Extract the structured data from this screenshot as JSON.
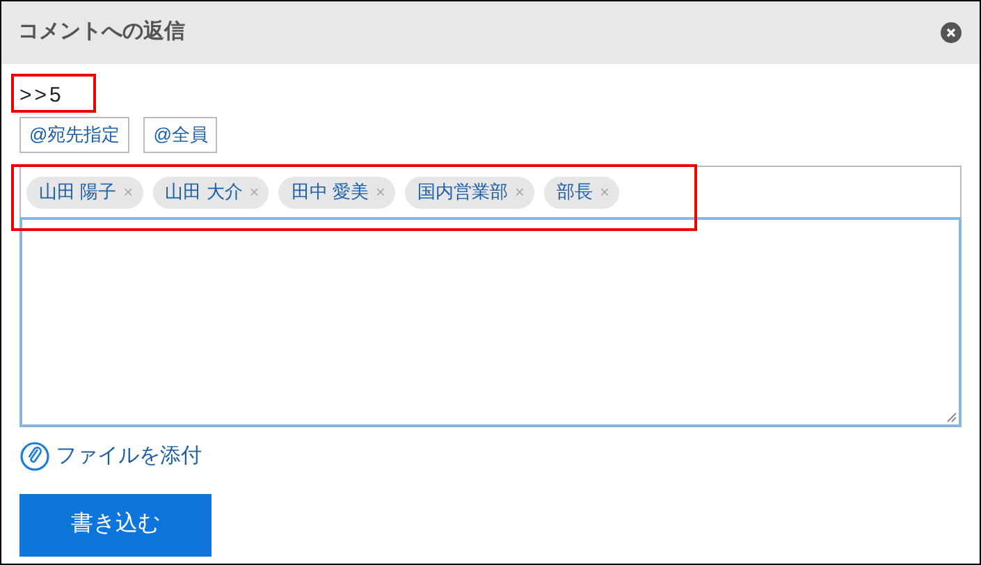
{
  "dialog": {
    "title": "コメントへの返信"
  },
  "quote": ">>5",
  "mention_buttons": [
    "@宛先指定",
    "@全員"
  ],
  "recipients": [
    {
      "label": "山田 陽子",
      "remove": "×"
    },
    {
      "label": "山田 大介",
      "remove": "×"
    },
    {
      "label": "田中 愛美",
      "remove": "×"
    },
    {
      "label": "国内営業部",
      "remove": "×"
    },
    {
      "label": "部長",
      "remove": "×"
    }
  ],
  "attach_link": "ファイルを添付",
  "submit_button": "書き込む"
}
